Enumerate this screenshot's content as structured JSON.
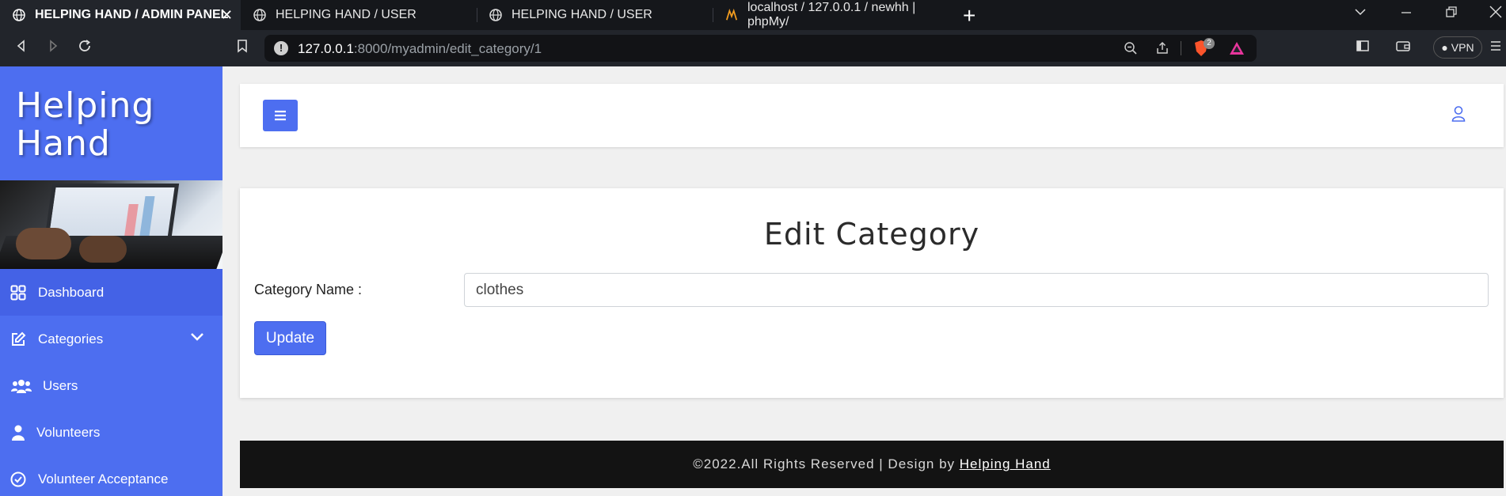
{
  "browser": {
    "tabs": [
      {
        "title": "HELPING HAND / ADMIN PANEL",
        "active": true,
        "icon": "globe-icon"
      },
      {
        "title": "HELPING HAND / USER",
        "active": false,
        "icon": "globe-icon"
      },
      {
        "title": "HELPING HAND / USER",
        "active": false,
        "icon": "globe-icon"
      },
      {
        "title": "localhost / 127.0.0.1 / newhh | phpMy/",
        "active": false,
        "icon": "phpmyadmin-icon"
      }
    ],
    "url_host": "127.0.0.1",
    "url_rest": ":8000/myadmin/edit_category/1",
    "brave_badge": "2",
    "vpn_label": "VPN"
  },
  "sidebar": {
    "brand_line1": "Helping",
    "brand_line2": "Hand",
    "items": [
      {
        "label": "Dashboard",
        "icon": "dashboard-icon",
        "active": true
      },
      {
        "label": "Categories",
        "icon": "edit-icon",
        "active": false
      },
      {
        "label": "Users",
        "icon": "users-icon",
        "active": false
      },
      {
        "label": "Volunteers",
        "icon": "user-icon",
        "active": false
      },
      {
        "label": "Volunteer Acceptance",
        "icon": "check-circle-icon",
        "active": false
      }
    ]
  },
  "form": {
    "title": "Edit Category",
    "label": "Category Name :",
    "value": "clothes",
    "button": "Update"
  },
  "footer": {
    "text": "©2022.All Rights Reserved | Design by ",
    "link": "Helping Hand"
  },
  "colors": {
    "accent": "#4d6ef0",
    "footer_bg": "#131313",
    "browser_chrome": "#22252b"
  }
}
